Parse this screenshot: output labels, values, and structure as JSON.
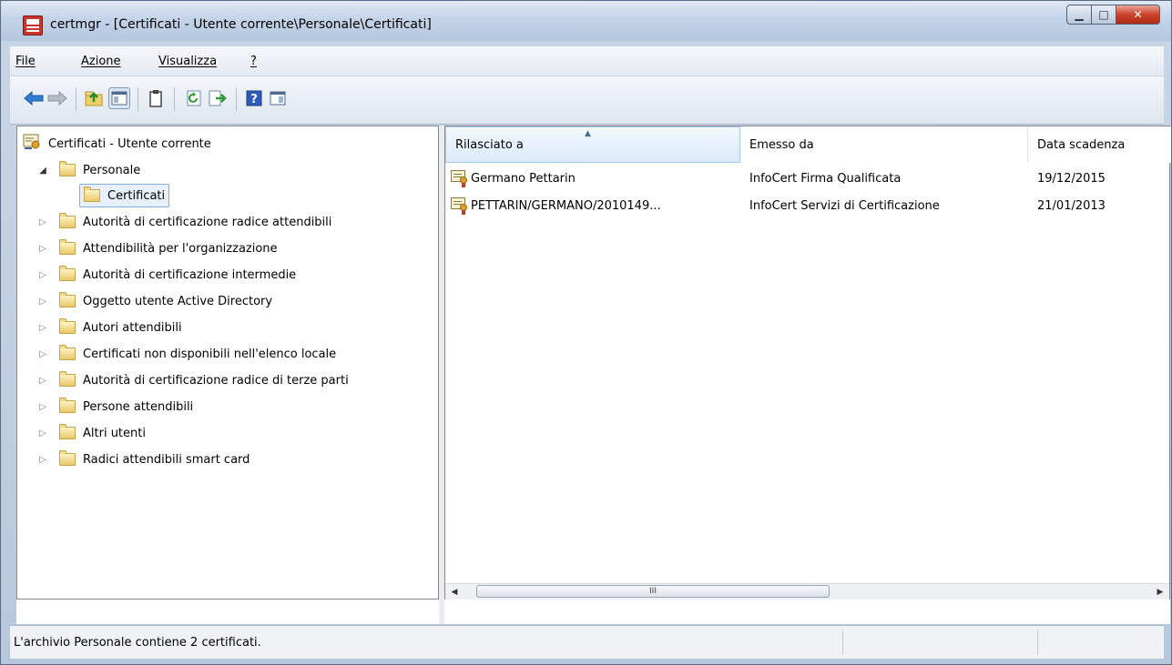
{
  "window": {
    "title": "certmgr - [Certificati - Utente corrente\\Personale\\Certificati]",
    "controls": {
      "minimize": "▁",
      "maximize": "□",
      "close": "✕"
    }
  },
  "menu": [
    "File",
    "Azione",
    "Visualizza",
    "?"
  ],
  "toolbar": {
    "icons": [
      "back-arrow-icon",
      "forward-arrow-icon",
      "up-folder-icon",
      "show-hide-tree-icon",
      "clipboard-icon",
      "refresh-icon",
      "export-list-icon",
      "help-icon",
      "properties-pane-icon"
    ]
  },
  "tree": {
    "root": "Certificati - Utente corrente",
    "items": [
      {
        "label": "Personale",
        "expanded": true
      },
      {
        "label": "Certificati",
        "selected": true
      },
      {
        "label": "Autorità di certificazione radice attendibili"
      },
      {
        "label": "Attendibilità per l'organizzazione"
      },
      {
        "label": "Autorità di certificazione intermedie"
      },
      {
        "label": "Oggetto utente Active Directory"
      },
      {
        "label": "Autori attendibili"
      },
      {
        "label": "Certificati non disponibili nell'elenco locale"
      },
      {
        "label": "Autorità di certificazione radice di terze parti"
      },
      {
        "label": "Persone attendibili"
      },
      {
        "label": "Altri utenti"
      },
      {
        "label": "Radici attendibili smart card"
      }
    ]
  },
  "list": {
    "columns": [
      "Rilasciato a",
      "Emesso da",
      "Data scadenza"
    ],
    "rows": [
      {
        "issued_to": "Germano Pettarin",
        "issued_by": "InfoCert Firma Qualificata",
        "expires": "19/12/2015"
      },
      {
        "issued_to": "PETTARIN/GERMANO/2010149...",
        "issued_by": "InfoCert Servizi di Certificazione",
        "expires": "21/01/2013"
      }
    ],
    "scroll_thumb": "III"
  },
  "status": {
    "text": "L'archivio Personale contiene 2 certificati."
  }
}
